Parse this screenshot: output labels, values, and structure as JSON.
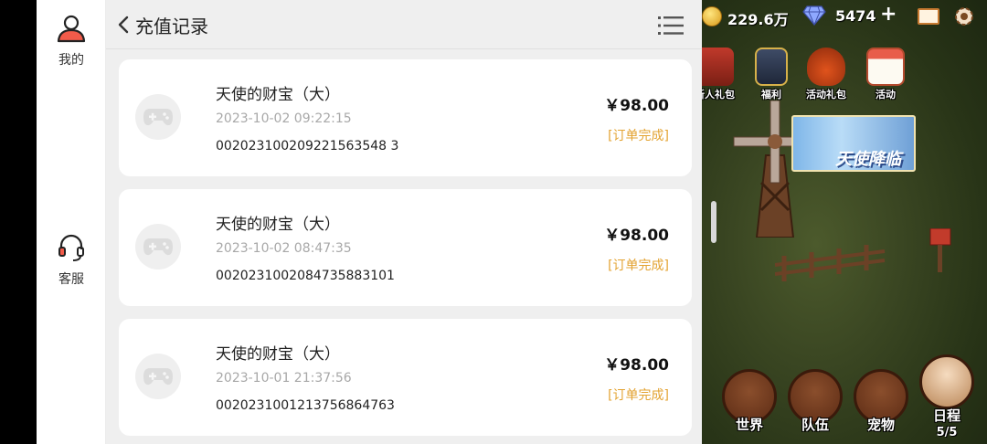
{
  "sidenav": {
    "me_label": "我的",
    "service_label": "客服",
    "user_icon": "user-icon",
    "service_icon": "headset-icon"
  },
  "header": {
    "title": "充值记录",
    "back_icon": "chevron-left-icon",
    "menu_icon": "list-icon"
  },
  "records": [
    {
      "name": "天使的财宝（大）",
      "time": "2023-10-02 09:22:15",
      "order": "002023100209221563548 3",
      "price": "￥98.00",
      "status": "[订单完成]"
    },
    {
      "name": "天使的财宝（大）",
      "time": "2023-10-02 08:47:35",
      "order": "0020231002084735883101",
      "price": "￥98.00",
      "status": "[订单完成]"
    },
    {
      "name": "天使的财宝（大）",
      "time": "2023-10-01 21:37:56",
      "order": "0020231001213756864763",
      "price": "￥98.00",
      "status": "[订单完成]"
    }
  ],
  "game": {
    "coins": "229.6万",
    "gems": "5474",
    "plus": "+",
    "top_icons": [
      {
        "label": "新人礼包"
      },
      {
        "label": "福利"
      },
      {
        "label": "活动礼包"
      },
      {
        "label": "活动"
      }
    ],
    "banner_text": "天使降临",
    "bottom_buttons": [
      {
        "label": "世界"
      },
      {
        "label": "队伍"
      },
      {
        "label": "宠物"
      },
      {
        "label": "日程",
        "sub": "5/5"
      }
    ],
    "colors": {
      "accent": "#e3a332",
      "panel_bg": "#efefef"
    }
  }
}
